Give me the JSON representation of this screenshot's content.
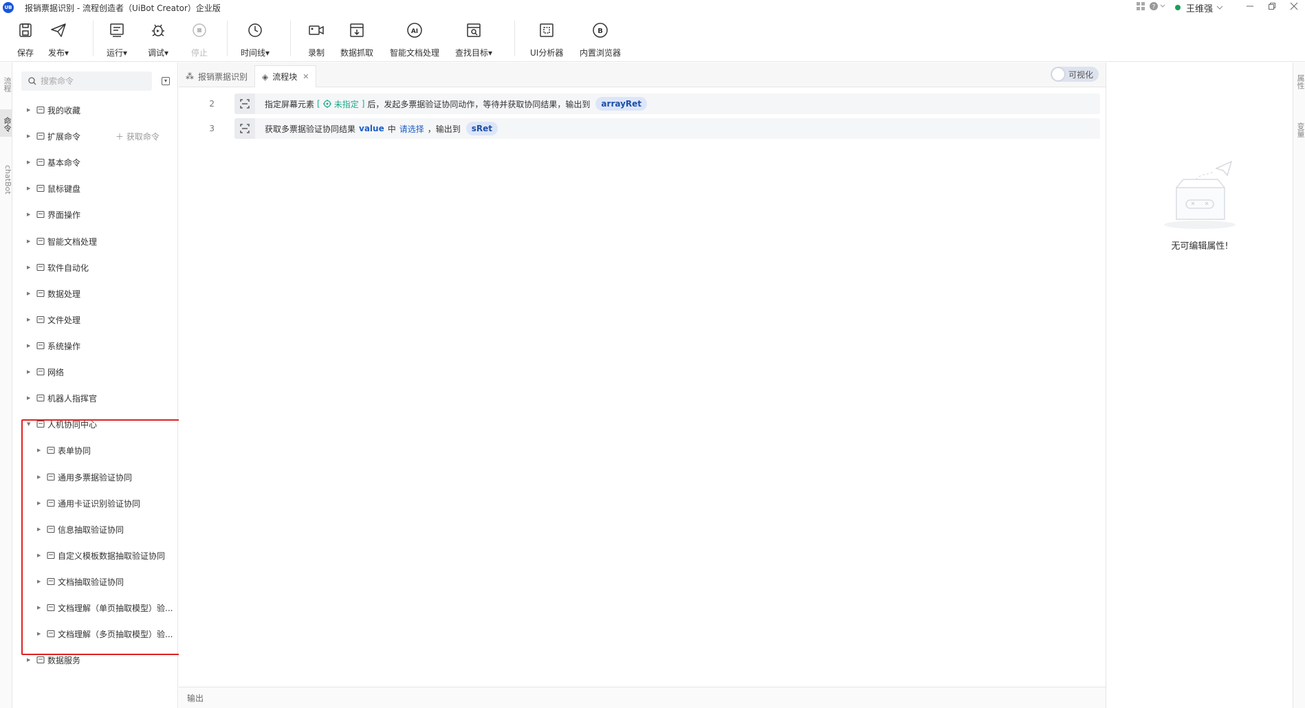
{
  "window": {
    "title": "报销票据识别 - 流程创造者（UiBot Creator）企业版",
    "logo_text": "UB",
    "user_name": "王维强",
    "icons": [
      "apps-icon",
      "help-icon",
      "minimize-icon",
      "restore-icon",
      "close-icon"
    ]
  },
  "toolbar": {
    "save": "保存",
    "publish": "发布▾",
    "run": "运行▾",
    "debug": "调试▾",
    "stop": "停止",
    "timeline": "时间线▾",
    "record": "录制",
    "data_scrape": "数据抓取",
    "smart_doc": "智能文档处理",
    "find_target": "查找目标▾",
    "ui_analyzer": "UI分析器",
    "builtin_browser": "内置浏览器"
  },
  "left_strip": {
    "tabs": [
      "流程",
      "命令",
      "chatBot"
    ]
  },
  "command_panel": {
    "search_placeholder": "搜索命令",
    "get_command": "获取命令",
    "items": [
      {
        "label": "我的收藏",
        "icon": "folder-icon"
      },
      {
        "label": "扩展命令",
        "icon": "extension-icon"
      },
      {
        "label": "基本命令",
        "icon": "basic-icon"
      },
      {
        "label": "鼠标键盘",
        "icon": "keyboard-icon"
      },
      {
        "label": "界面操作",
        "icon": "window-icon"
      },
      {
        "label": "智能文档处理",
        "icon": "ai-doc-icon"
      },
      {
        "label": "软件自动化",
        "icon": "automation-icon"
      },
      {
        "label": "数据处理",
        "icon": "pie-icon"
      },
      {
        "label": "文件处理",
        "icon": "file-icon"
      },
      {
        "label": "系统操作",
        "icon": "monitor-icon"
      },
      {
        "label": "网络",
        "icon": "globe-icon"
      },
      {
        "label": "机器人指挥官",
        "icon": "robot-icon"
      },
      {
        "label": "人机协同中心",
        "icon": "collab-icon"
      },
      {
        "label": "表单协同",
        "icon": "form-icon"
      },
      {
        "label": "通用多票据验证协同",
        "icon": "scan-icon"
      },
      {
        "label": "通用卡证识别验证协同",
        "icon": "card-icon"
      },
      {
        "label": "信息抽取验证协同",
        "icon": "extract-icon"
      },
      {
        "label": "自定义模板数据抽取验证协同",
        "icon": "template-icon"
      },
      {
        "label": "文档抽取验证协同",
        "icon": "doc-icon"
      },
      {
        "label": "文档理解（单页抽取模型）验...",
        "icon": "doc-understand-icon"
      },
      {
        "label": "文档理解（多页抽取模型）验...",
        "icon": "doc-understand-multi-icon"
      },
      {
        "label": "数据服务",
        "icon": "chart-icon"
      }
    ]
  },
  "editor": {
    "tabs": [
      {
        "label": "报销票据识别",
        "active": false
      },
      {
        "label": "流程块",
        "active": true
      }
    ],
    "visualize_label": "可视化",
    "lines": [
      {
        "num": "2",
        "prefix": "指定屏幕元素",
        "bracket_open": "[",
        "target": "未指定",
        "bracket_close": "]",
        "middle": "后，发起多票据验证协同动作，等待并获取协同结果，输出到",
        "var": "arrayRet"
      },
      {
        "num": "3",
        "prefix": "获取多票据验证协同结果",
        "kw": "value",
        "in": "中",
        "link": "请选择",
        "middle": "，输出到",
        "var": "sRet"
      }
    ],
    "output_label": "输出"
  },
  "properties": {
    "empty_text": "无可编辑属性!"
  },
  "right_strip": {
    "tabs": [
      "属性",
      "变量"
    ]
  },
  "colors": {
    "accent": "#1c5fc6",
    "green": "#1eab8a",
    "highlight_border": "#e02020"
  }
}
